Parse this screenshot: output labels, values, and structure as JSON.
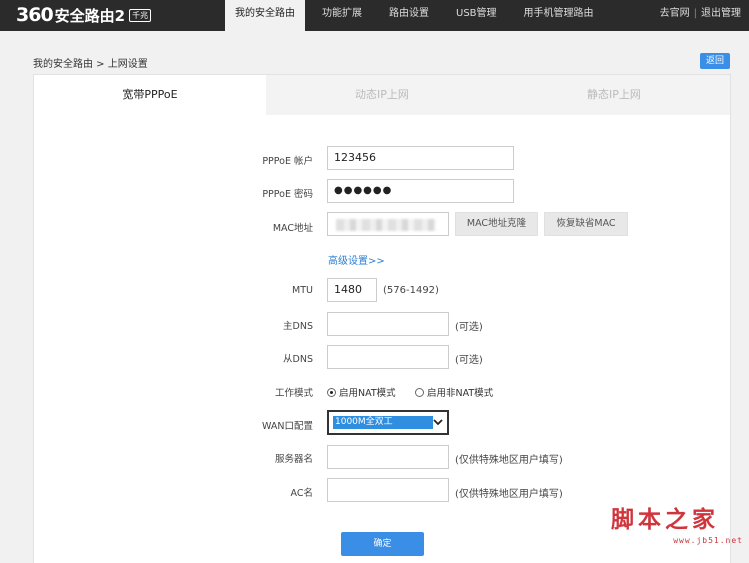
{
  "brand": {
    "logo_number": "360",
    "logo_name": "安全路由2",
    "logo_badge": "千兆"
  },
  "nav": {
    "items": [
      "我的安全路由",
      "功能扩展",
      "路由设置",
      "USB管理",
      "用手机管理路由"
    ],
    "active_index": 0
  },
  "topright": {
    "official_site": "去官网",
    "sep": "|",
    "logout": "退出管理"
  },
  "breadcrumb": "我的安全路由 > 上网设置",
  "back_button": "返回",
  "tabs": [
    {
      "label": "宽带PPPoE",
      "active": true
    },
    {
      "label": "动态IP上网",
      "active": false
    },
    {
      "label": "静态IP上网",
      "active": false
    }
  ],
  "form": {
    "pppoe_account": {
      "label": "PPPoE 帐户",
      "value": "123456"
    },
    "pppoe_password": {
      "label": "PPPoE 密码",
      "value": "●●●●●●"
    },
    "mac": {
      "label": "MAC地址",
      "clone_button": "MAC地址克隆",
      "restore_button": "恢复缺省MAC"
    },
    "advanced_link": "高级设置>>",
    "mtu": {
      "label": "MTU",
      "value": "1480",
      "note": "(576-1492)"
    },
    "primary_dns": {
      "label": "主DNS",
      "value": "",
      "note": "(可选)"
    },
    "secondary_dns": {
      "label": "从DNS",
      "value": "",
      "note": "(可选)"
    },
    "work_mode": {
      "label": "工作模式",
      "options": [
        "启用NAT模式",
        "启用非NAT模式"
      ],
      "selected_index": 0
    },
    "wan_config": {
      "label": "WAN口配置",
      "selected": "1000M全双工"
    },
    "server_name": {
      "label": "服务器名",
      "value": "",
      "note": "(仅供特殊地区用户填写)"
    },
    "ac_name": {
      "label": "AC名",
      "value": "",
      "note": "(仅供特殊地区用户填写)"
    },
    "confirm_button": "确定"
  },
  "watermark": {
    "text": "脚本之家",
    "url": "www.jb51.net"
  },
  "colors": {
    "topbar": "#2b2b2b",
    "accent": "#3a8ee6",
    "link": "#2a7fd4",
    "watermark": "#d0343c"
  }
}
